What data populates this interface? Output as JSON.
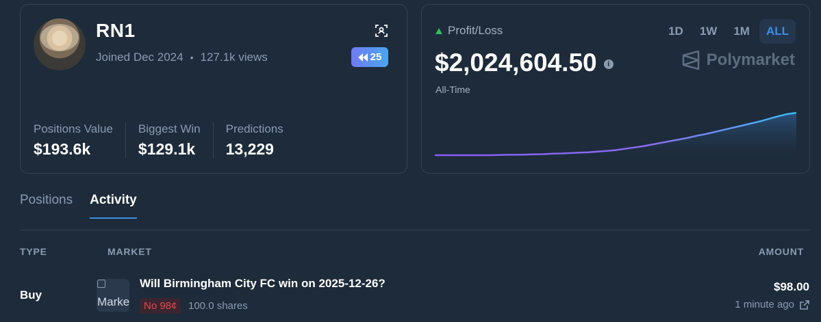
{
  "profile": {
    "username": "RN1",
    "joined": "Joined Dec 2024",
    "views": "127.1k views",
    "rank_badge": "25",
    "stats": [
      {
        "label": "Positions Value",
        "value": "$193.6k"
      },
      {
        "label": "Biggest Win",
        "value": "$129.1k"
      },
      {
        "label": "Predictions",
        "value": "13,229"
      }
    ]
  },
  "pnl": {
    "label": "Profit/Loss",
    "value": "$2,024,604.50",
    "period": "All-Time",
    "brand": "Polymarket",
    "ranges": [
      "1D",
      "1W",
      "1M",
      "ALL"
    ],
    "active_range": "ALL",
    "colors": {
      "up": "#2fbf5e",
      "line_start": "#8b5cf6",
      "line_end": "#38bdf8"
    }
  },
  "tabs": [
    {
      "label": "Positions",
      "active": false
    },
    {
      "label": "Activity",
      "active": true
    }
  ],
  "table": {
    "headers": {
      "type": "TYPE",
      "market": "MARKET",
      "amount": "AMOUNT"
    },
    "rows": [
      {
        "type": "Buy",
        "thumb_alt": "Market icon",
        "market": "Will Birmingham City FC win on 2025-12-26?",
        "outcome": "No 98¢",
        "shares": "100.0 shares",
        "amount": "$98.00",
        "time": "1 minute ago"
      }
    ]
  },
  "chart_data": {
    "type": "area",
    "title": "",
    "xlabel": "",
    "ylabel": "",
    "x": [
      0,
      1,
      2,
      3,
      4,
      5,
      6,
      7,
      8,
      9,
      10,
      11,
      12,
      13,
      14,
      15,
      16,
      17,
      18,
      19,
      20,
      21,
      22,
      23,
      24,
      25,
      26,
      27,
      28,
      29,
      30,
      31,
      32,
      33,
      34,
      35,
      36,
      37,
      38,
      39,
      40
    ],
    "series": [
      {
        "values": [
          0,
          0,
          0,
          0,
          0,
          0,
          0,
          0.005,
          0.01,
          0.01,
          0.015,
          0.02,
          0.025,
          0.035,
          0.04,
          0.05,
          0.06,
          0.07,
          0.085,
          0.1,
          0.12,
          0.15,
          0.18,
          0.21,
          0.25,
          0.29,
          0.33,
          0.37,
          0.41,
          0.46,
          0.5,
          0.55,
          0.6,
          0.65,
          0.7,
          0.75,
          0.8,
          0.86,
          0.92,
          0.97,
          1.0
        ]
      }
    ],
    "ylim": [
      0,
      1
    ],
    "grid": false,
    "legend": "none"
  }
}
